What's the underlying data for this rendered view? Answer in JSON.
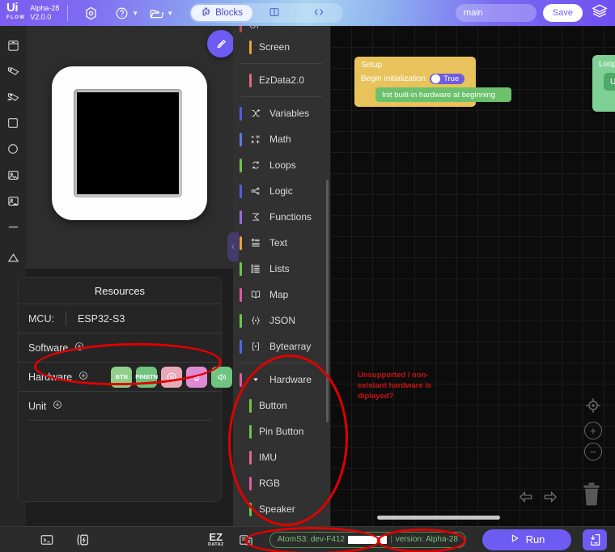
{
  "header": {
    "logo_name": "Ui",
    "logo_sub": "FLOW",
    "version_line1": "Alpha-28",
    "version_line2": "V2.0.0",
    "settings_icon": "settings-hexagon-icon",
    "help_icon": "help-circle-icon",
    "folder_icon": "folder-open-icon",
    "blocks_label": "Blocks",
    "blocks_icon": "puzzle-icon",
    "split_icon": "split-view-icon",
    "code_icon": "code-brackets-icon",
    "project_name": "main",
    "project_placeholder": "main",
    "save_label": "Save",
    "layers_icon": "layers-icon"
  },
  "rail": {
    "items": [
      {
        "name": "screen-icon"
      },
      {
        "name": "label-tag-icon"
      },
      {
        "name": "dynamic-label-icon"
      },
      {
        "name": "rectangle-icon"
      },
      {
        "name": "circle-icon"
      },
      {
        "name": "image-icon"
      },
      {
        "name": "dynamic-image-icon"
      },
      {
        "name": "line-icon"
      },
      {
        "name": "triangle-icon"
      }
    ]
  },
  "preview": {
    "device_name": "atoms3-device-preview",
    "draw_tool_icon": "pen-tool-icon"
  },
  "resources": {
    "title": "Resources",
    "mcu_label": "MCU:",
    "mcu_value": "ESP32-S3",
    "software_label": "Software",
    "hardware_label": "Hardware",
    "unit_label": "Unit",
    "add_icon": "plus-circle-icon",
    "hardware_badges": [
      {
        "label": "BTN",
        "name": "badge-button",
        "color": "#8fd08a"
      },
      {
        "label": "PIN\nBTN",
        "name": "badge-pin-button",
        "color": "#6fc47f"
      },
      {
        "label": "@",
        "name": "badge-imu",
        "color": "#e8a9b8"
      },
      {
        "label": "RGB",
        "name": "badge-rgb",
        "color": "#e08ad6"
      },
      {
        "label": "SPK",
        "name": "badge-speaker",
        "color": "#6fc47f"
      }
    ]
  },
  "blocks_panel": {
    "collapse_icon": "chevron-left-icon",
    "categories": [
      {
        "label": "UI",
        "icon": "",
        "color": "#e05a5a",
        "indent": false,
        "cut": true
      },
      {
        "label": "Screen",
        "icon": "",
        "color": "#e8a33a",
        "indent": true
      },
      {
        "divider": true
      },
      {
        "label": "EzData2.0",
        "icon": "",
        "color": "#e06a85",
        "indent": true
      },
      {
        "divider": true
      },
      {
        "label": "Variables",
        "icon": "variables-icon",
        "color": "#5a5ae0"
      },
      {
        "label": "Math",
        "icon": "math-icon",
        "color": "#5a7ae0"
      },
      {
        "label": "Loops",
        "icon": "loops-icon",
        "color": "#6fc44a"
      },
      {
        "label": "Logic",
        "icon": "logic-icon",
        "color": "#5a5ae0"
      },
      {
        "label": "Functions",
        "icon": "functions-icon",
        "color": "#9a6ae0"
      },
      {
        "label": "Text",
        "icon": "text-icon",
        "color": "#e8a33a"
      },
      {
        "label": "Lists",
        "icon": "lists-icon",
        "color": "#6fc44a"
      },
      {
        "label": "Map",
        "icon": "map-icon",
        "color": "#e05aa8"
      },
      {
        "label": "JSON",
        "icon": "json-icon",
        "color": "#6fc44a"
      },
      {
        "label": "Bytearray",
        "icon": "bytearray-icon",
        "color": "#4a6ae0"
      },
      {
        "divider": true
      },
      {
        "label": "Hardware",
        "icon": "triangle-down-icon",
        "color": "#e05aa8",
        "expanded": true
      },
      {
        "label": "Button",
        "icon": "",
        "color": "#6fc44a",
        "indent": true
      },
      {
        "label": "Pin Button",
        "icon": "",
        "color": "#6fc44a",
        "indent": true
      },
      {
        "label": "IMU",
        "icon": "",
        "color": "#e06a85",
        "indent": true
      },
      {
        "label": "RGB",
        "icon": "",
        "color": "#e05aa8",
        "indent": true
      },
      {
        "label": "Speaker",
        "icon": "",
        "color": "#6fc44a",
        "indent": true
      }
    ]
  },
  "workspace": {
    "setup_block": {
      "title": "Setup",
      "init_label": "Begin initialization",
      "toggle_value": "True",
      "child_label": "Init built-in hardware at beginning"
    },
    "loop_block": {
      "title": "Loop",
      "child_label": "U"
    },
    "annotation": "Unsupported / non-existant hardware is diplayed?",
    "controls": [
      {
        "name": "center-view-icon",
        "glyph": "⊙"
      },
      {
        "name": "zoom-in-icon",
        "glyph": "+"
      },
      {
        "name": "zoom-out-icon",
        "glyph": "−"
      },
      {
        "name": "undo-icon",
        "glyph": "⇦"
      },
      {
        "name": "redo-icon",
        "glyph": "⇨"
      },
      {
        "name": "trash-icon",
        "glyph": ""
      }
    ]
  },
  "statusbar": {
    "terminal_icon": "terminal-icon",
    "flash-icon": "flash-icon",
    "ezdata_label": "EZ",
    "ezdata_sub": "DATA2",
    "screenshot_icon": "device-copy-icon",
    "device_text": "AtomS3: dev-F412",
    "version_text": "version: Alpha-28",
    "run_label": "Run",
    "run_icon": "play-icon",
    "download_icon": "download-device-icon"
  },
  "colors": {
    "accent": "#6e5bf2",
    "annotation_red": "#e00000",
    "status_green": "#79c379",
    "setup_yellow": "#e8c25a",
    "block_green": "#6cc16c"
  }
}
